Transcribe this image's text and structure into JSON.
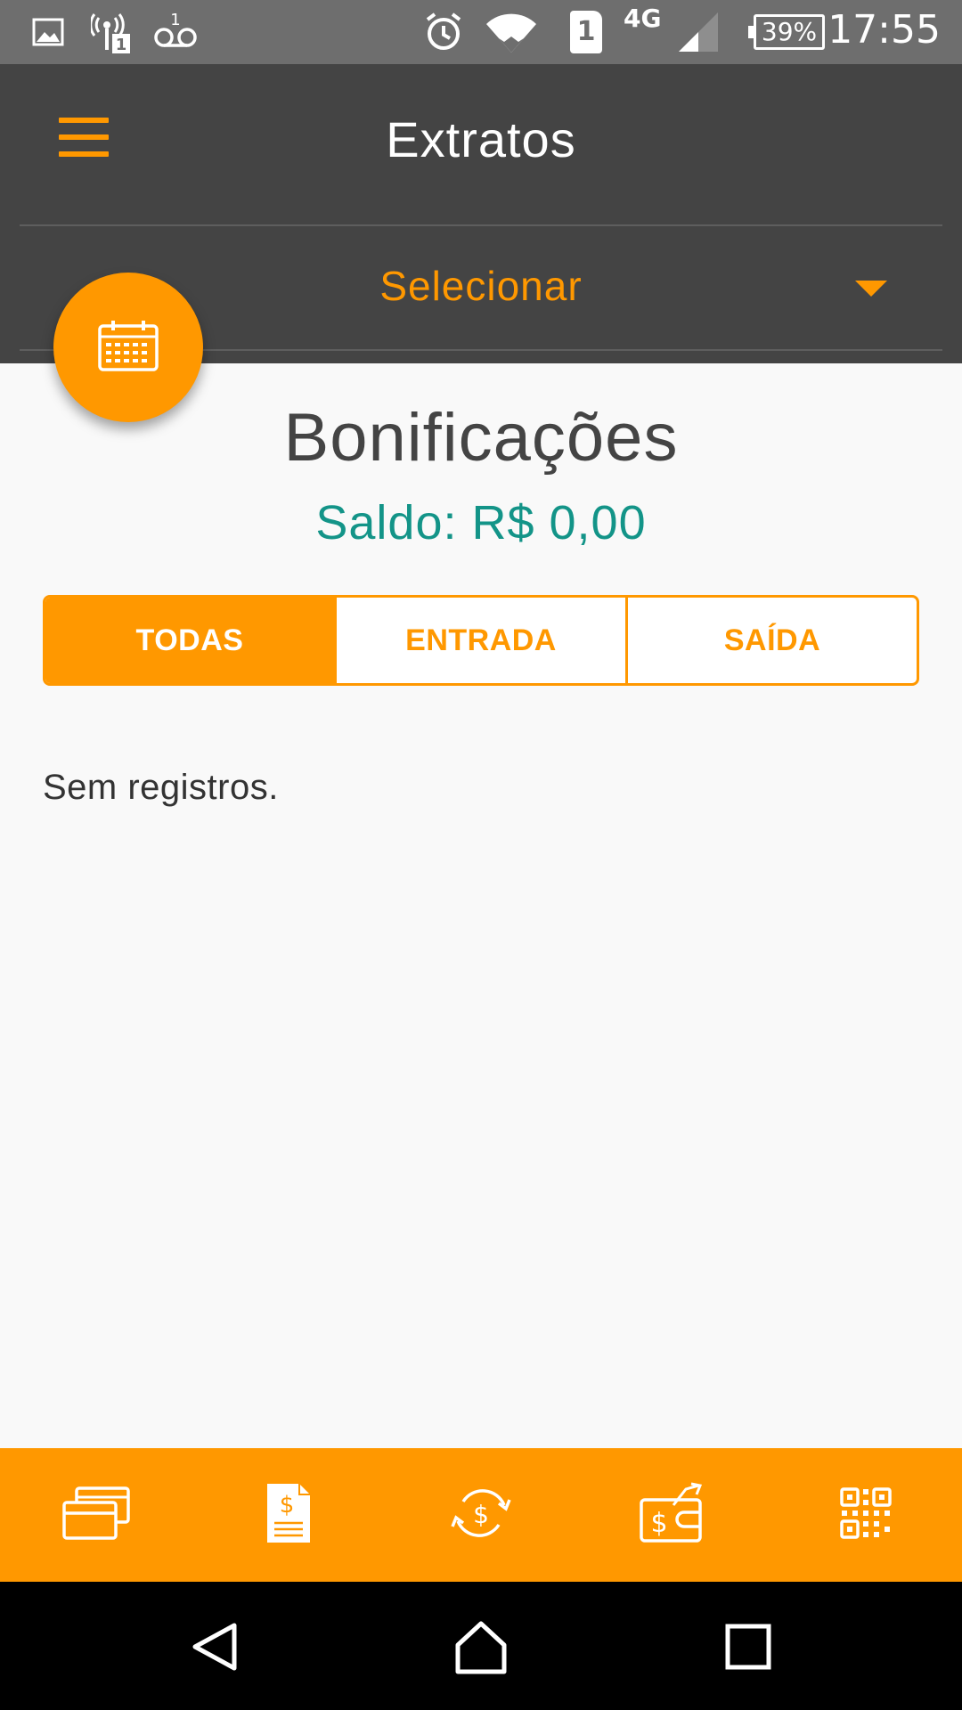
{
  "status_bar": {
    "time": "17:55",
    "battery_label": "39%",
    "sim_slot": "1",
    "network_type": "4G",
    "voicemail_count": "1",
    "icons": [
      "image-icon",
      "hotspot-icon",
      "voicemail-icon",
      "alarm-icon",
      "wifi-icon",
      "sim-icon",
      "signal-icon",
      "battery-icon"
    ]
  },
  "header": {
    "title": "Extratos",
    "menu_icon": "hamburger-menu-icon",
    "selector_label": "Selecionar",
    "selector_icon": "caret-down-icon"
  },
  "fab": {
    "icon": "calendar-icon"
  },
  "content": {
    "section_title": "Bonificações",
    "balance_text": "Saldo: R$ 0,00",
    "empty_message": "Sem registros."
  },
  "tabs": [
    {
      "label": "TODAS",
      "active": true
    },
    {
      "label": "ENTRADA",
      "active": false
    },
    {
      "label": "SAÍDA",
      "active": false
    }
  ],
  "bottom_nav": {
    "items": [
      "cards-icon",
      "invoice-icon",
      "transfer-icon",
      "wallet-icon",
      "qr-code-icon"
    ]
  },
  "system_nav": {
    "items": [
      "back-icon",
      "home-icon",
      "recents-icon"
    ]
  },
  "colors": {
    "accent": "#ff9800",
    "header_bg": "#444444",
    "status_bg": "#6e6e6e",
    "balance": "#139488",
    "background": "#f9f9f9"
  }
}
